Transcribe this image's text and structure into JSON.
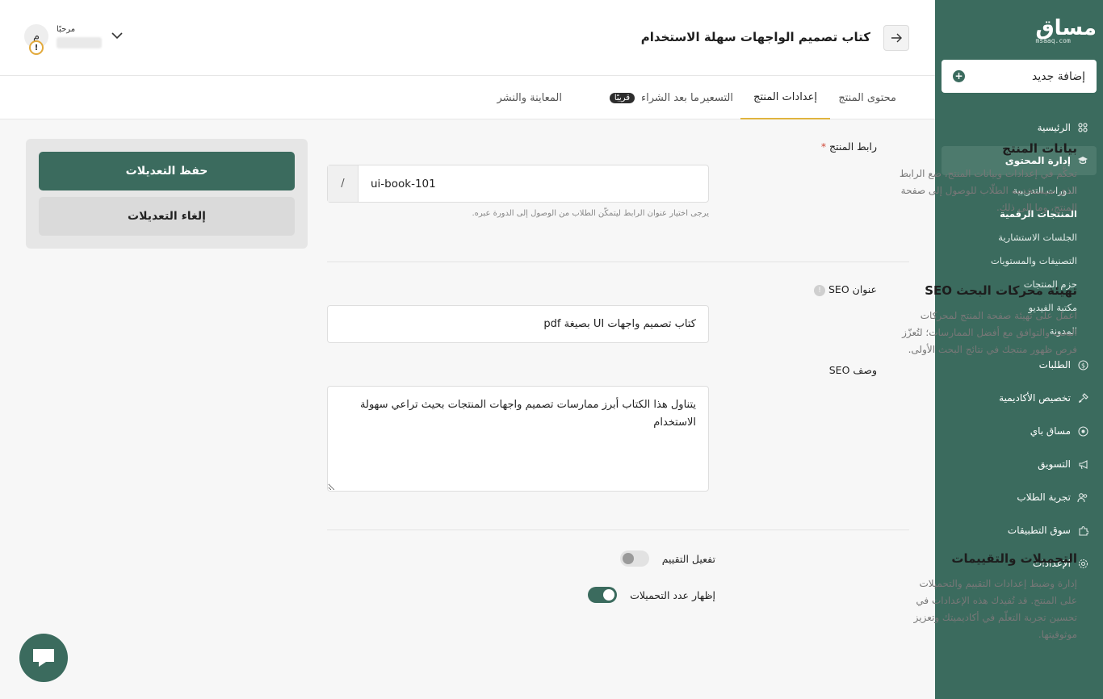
{
  "sidebar": {
    "logo": "مساق",
    "logo_sub": "msaaq.com",
    "add_new": "إضافة جديد",
    "items": [
      {
        "label": "الرئيسية",
        "icon": "grid-icon"
      },
      {
        "label": "إدارة المحتوى",
        "icon": "graduation-cap-icon",
        "active": true
      },
      {
        "label": "الطلبات",
        "icon": "dollar-icon"
      },
      {
        "label": "تخصيص الأكاديمية",
        "icon": "brush-icon"
      },
      {
        "label": "مساق باي",
        "icon": "pay-icon"
      },
      {
        "label": "التسويق",
        "icon": "megaphone-icon"
      },
      {
        "label": "تجربة الطلاب",
        "icon": "users-icon"
      },
      {
        "label": "سوق التطبيقات",
        "icon": "puzzle-icon"
      },
      {
        "label": "الإعدادات",
        "icon": "gear-icon"
      }
    ],
    "sub_items": [
      {
        "label": "الدورات التدريبية"
      },
      {
        "label": "المنتجات الرقمية",
        "active": true
      },
      {
        "label": "الجلسات الاستشارية"
      },
      {
        "label": "التصنيفات والمستويات"
      },
      {
        "label": "حزم المنتجات"
      },
      {
        "label": "مكتبة الفيديو"
      },
      {
        "label": "المدونة"
      }
    ]
  },
  "header": {
    "title": "كتاب تصميم الواجهات سهلة الاستخدام",
    "greeting": "مرحبًا",
    "avatar_initial": "م",
    "warning_glyph": "!"
  },
  "tabs": [
    {
      "label": "محتوى المنتج"
    },
    {
      "label": "إعدادات المنتج",
      "active": true
    },
    {
      "label": "التسعير"
    },
    {
      "label": "ما بعد الشراء",
      "badge": "قريبًا"
    },
    {
      "label": "المعاينة والنشر"
    }
  ],
  "product_data": {
    "title": "بيانات المنتج",
    "description": "تحكَّم في إعدادات وبيانات المنتج، ضع الرابط الذي سيستخدمه الطلّاب للوصول إلى صفحة المنتج، وما إلى ذلك.",
    "url_label": "رابط المنتج",
    "required_mark": "*",
    "url_prefix": "/",
    "url_value": "ui-book-101",
    "url_hint": "يرجى اختيار عنوان الرابط ليتمكّن الطلاب من الوصول إلى الدورة عبره."
  },
  "seo": {
    "title": "تهيئة محركات البحث SEO",
    "description": "اعمل على تهيئة صفحة المنتج لمحركات البحث والتوافق مع أفضل الممارسات؛ لتُعزّز فرص ظهور منتجك في نتائج البحث الأولى.",
    "title_label": "عنوان SEO",
    "info_glyph": "!",
    "title_value": "كتاب تصميم واجهات UI بصيغة pdf",
    "desc_label": "وصف SEO",
    "desc_value": "يتناول هذا الكتاب أبرز ممارسات تصميم واجهات المنتجات بحيث تراعي سهولة الاستخدام"
  },
  "downloads": {
    "title": "التحميلات والتقييمات",
    "description": "إدارة وضبط إعدادات التقييم والتحميلات على المنتج. قد تُفيدك هذه الإعدادات في تحسين تجربة التعلّم في أكاديميتك وتعزيز موثوقيتها.",
    "toggle_rating": {
      "label": "تفعيل التقييم",
      "on": false
    },
    "toggle_downloads": {
      "label": "إظهار عدد التحميلات",
      "on": true
    }
  },
  "actions": {
    "save": "حفظ التعديلات",
    "cancel": "إلغاء التعديلات"
  },
  "colors": {
    "brand": "#3b6b5e",
    "accent": "#e0b43e"
  }
}
